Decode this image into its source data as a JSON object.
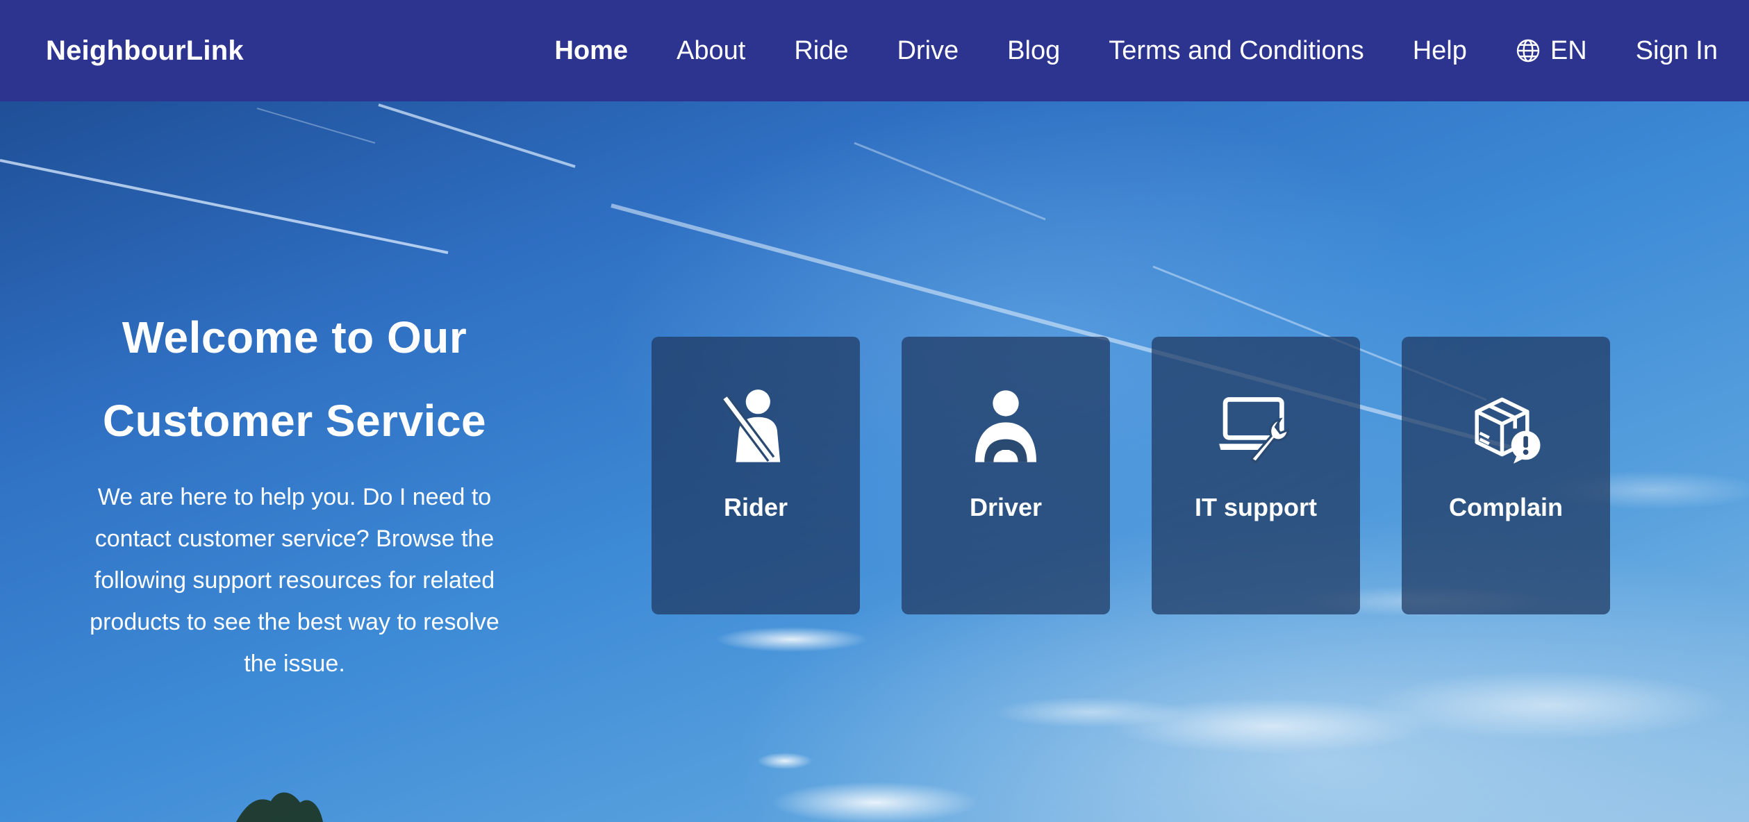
{
  "brand": "NeighbourLink",
  "nav": {
    "items": [
      {
        "label": "Home",
        "active": true
      },
      {
        "label": "About"
      },
      {
        "label": "Ride"
      },
      {
        "label": "Drive"
      },
      {
        "label": "Blog"
      },
      {
        "label": "Terms and Conditions"
      },
      {
        "label": "Help"
      }
    ],
    "language": {
      "label": "EN",
      "icon": "globe-icon"
    },
    "sign_in": "Sign In"
  },
  "hero": {
    "title_line1": "Welcome to Our",
    "title_line2": "Customer Service",
    "description": "We are here to help you. Do I need to contact customer service? Browse the following support resources for related products to see the best way to resolve the issue."
  },
  "cards": [
    {
      "label": "Rider",
      "icon": "rider-seatbelt-icon"
    },
    {
      "label": "Driver",
      "icon": "driver-steering-wheel-icon"
    },
    {
      "label": "IT support",
      "icon": "laptop-wrench-icon"
    },
    {
      "label": "Complain",
      "icon": "package-alert-icon"
    }
  ],
  "colors": {
    "navbar": "#2d348f",
    "card_background": "rgba(30,55,95,0.72)",
    "text": "#ffffff"
  }
}
